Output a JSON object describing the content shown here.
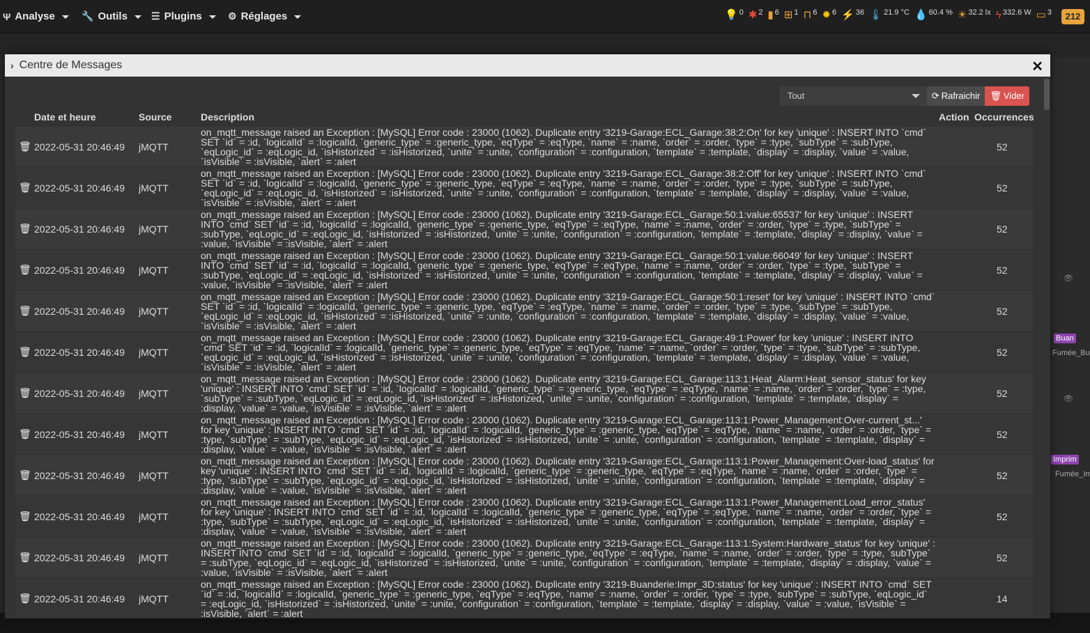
{
  "nav": {
    "analyse": "Analyse",
    "outils": "Outils",
    "plugins": "Plugins",
    "reglages": "Réglages"
  },
  "status": [
    {
      "icon": "bulb-icon",
      "glyph": "💡",
      "value": "0",
      "color": "#a6d14a"
    },
    {
      "icon": "person-running-icon",
      "glyph": "✱",
      "value": "2",
      "color": "#e74c3c"
    },
    {
      "icon": "door-icon",
      "glyph": "▮",
      "value": "6",
      "color": "#e8a33a"
    },
    {
      "icon": "window-icon",
      "glyph": "⊞",
      "value": "1",
      "color": "#e8a33a"
    },
    {
      "icon": "shutter-icon",
      "glyph": "⊓",
      "value": "6",
      "color": "#e8a33a"
    },
    {
      "icon": "lamp-icon",
      "glyph": "✹",
      "value": "6",
      "color": "#f1c40f"
    },
    {
      "icon": "plug-icon",
      "glyph": "⚡",
      "value": "36",
      "color": "#e74c3c"
    },
    {
      "icon": "thermometer-icon",
      "glyph": "🌡",
      "value": "21.9 °C",
      "color": "#5dade2"
    },
    {
      "icon": "humidity-icon",
      "glyph": "💧",
      "value": "60.4 %",
      "color": "#3498db"
    },
    {
      "icon": "sun-icon",
      "glyph": "☀",
      "value": "32.2 lx",
      "color": "#e8a33a"
    },
    {
      "icon": "power-icon",
      "glyph": "ϟ",
      "value": "332.6 W",
      "color": "#e74c3c"
    },
    {
      "icon": "screen-icon",
      "glyph": "▭",
      "value": "3",
      "color": "#e8a33a"
    }
  ],
  "notification_count": "212",
  "modal": {
    "title": "Centre de Messages",
    "filter_value": "Tout",
    "refresh_label": "Rafraichir",
    "clear_label": "Vider"
  },
  "table": {
    "headers": {
      "date": "Date et heure",
      "source": "Source",
      "description": "Description",
      "action": "Action",
      "occurrences": "Occurrences"
    },
    "rows": [
      {
        "date": "2022-05-31 20:46:49",
        "source": "jMQTT",
        "occ": "52",
        "desc": "on_mqtt_message raised an Exception : [MySQL] Error code : 23000 (1062). Duplicate entry '3219-Garage:ECL_Garage:38:2:On' for key 'unique' : INSERT INTO `cmd` SET `id` = :id, `logicalId` = :logicalId, `generic_type` = :generic_type, `eqType` = :eqType, `name` = :name, `order` = :order, `type` = :type, `subType` = :subType, `eqLogic_id` = :eqLogic_id, `isHistorized` = :isHistorized, `unite` = :unite, `configuration` = :configuration, `template` = :template, `display` = :display, `value` = :value, `isVisible` = :isVisible, `alert` = :alert"
      },
      {
        "date": "2022-05-31 20:46:49",
        "source": "jMQTT",
        "occ": "52",
        "desc": "on_mqtt_message raised an Exception : [MySQL] Error code : 23000 (1062). Duplicate entry '3219-Garage:ECL_Garage:38:2:Off' for key 'unique' : INSERT INTO `cmd` SET `id` = :id, `logicalId` = :logicalId, `generic_type` = :generic_type, `eqType` = :eqType, `name` = :name, `order` = :order, `type` = :type, `subType` = :subType, `eqLogic_id` = :eqLogic_id, `isHistorized` = :isHistorized, `unite` = :unite, `configuration` = :configuration, `template` = :template, `display` = :display, `value` = :value, `isVisible` = :isVisible, `alert` = :alert"
      },
      {
        "date": "2022-05-31 20:46:49",
        "source": "jMQTT",
        "occ": "52",
        "desc": "on_mqtt_message raised an Exception : [MySQL] Error code : 23000 (1062). Duplicate entry '3219-Garage:ECL_Garage:50:1:value:65537' for key 'unique' : INSERT INTO `cmd` SET `id` = :id, `logicalId` = :logicalId, `generic_type` = :generic_type, `eqType` = :eqType, `name` = :name, `order` = :order, `type` = :type, `subType` = :subType, `eqLogic_id` = :eqLogic_id, `isHistorized` = :isHistorized, `unite` = :unite, `configuration` = :configuration, `template` = :template, `display` = :display, `value` = :value, `isVisible` = :isVisible, `alert` = :alert"
      },
      {
        "date": "2022-05-31 20:46:49",
        "source": "jMQTT",
        "occ": "52",
        "desc": "on_mqtt_message raised an Exception : [MySQL] Error code : 23000 (1062). Duplicate entry '3219-Garage:ECL_Garage:50:1:value:66049' for key 'unique' : INSERT INTO `cmd` SET `id` = :id, `logicalId` = :logicalId, `generic_type` = :generic_type, `eqType` = :eqType, `name` = :name, `order` = :order, `type` = :type, `subType` = :subType, `eqLogic_id` = :eqLogic_id, `isHistorized` = :isHistorized, `unite` = :unite, `configuration` = :configuration, `template` = :template, `display` = :display, `value` = :value, `isVisible` = :isVisible, `alert` = :alert"
      },
      {
        "date": "2022-05-31 20:46:49",
        "source": "jMQTT",
        "occ": "52",
        "desc": "on_mqtt_message raised an Exception : [MySQL] Error code : 23000 (1062). Duplicate entry '3219-Garage:ECL_Garage:50:1:reset' for key 'unique' : INSERT INTO `cmd` SET `id` = :id, `logicalId` = :logicalId, `generic_type` = :generic_type, `eqType` = :eqType, `name` = :name, `order` = :order, `type` = :type, `subType` = :subType, `eqLogic_id` = :eqLogic_id, `isHistorized` = :isHistorized, `unite` = :unite, `configuration` = :configuration, `template` = :template, `display` = :display, `value` = :value, `isVisible` = :isVisible, `alert` = :alert"
      },
      {
        "date": "2022-05-31 20:46:49",
        "source": "jMQTT",
        "occ": "52",
        "desc": "on_mqtt_message raised an Exception : [MySQL] Error code : 23000 (1062). Duplicate entry '3219-Garage:ECL_Garage:49:1:Power' for key 'unique' : INSERT INTO `cmd` SET `id` = :id, `logicalId` = :logicalId, `generic_type` = :generic_type, `eqType` = :eqType, `name` = :name, `order` = :order, `type` = :type, `subType` = :subType, `eqLogic_id` = :eqLogic_id, `isHistorized` = :isHistorized, `unite` = :unite, `configuration` = :configuration, `template` = :template, `display` = :display, `value` = :value, `isVisible` = :isVisible, `alert` = :alert"
      },
      {
        "date": "2022-05-31 20:46:49",
        "source": "jMQTT",
        "occ": "52",
        "desc": "on_mqtt_message raised an Exception : [MySQL] Error code : 23000 (1062). Duplicate entry '3219-Garage:ECL_Garage:113:1:Heat_Alarm:Heat_sensor_status' for key 'unique' : INSERT INTO `cmd` SET `id` = :id, `logicalId` = :logicalId, `generic_type` = :generic_type, `eqType` = :eqType, `name` = :name, `order` = :order, `type` = :type, `subType` = :subType, `eqLogic_id` = :eqLogic_id, `isHistorized` = :isHistorized, `unite` = :unite, `configuration` = :configuration, `template` = :template, `display` = :display, `value` = :value, `isVisible` = :isVisible, `alert` = :alert"
      },
      {
        "date": "2022-05-31 20:46:49",
        "source": "jMQTT",
        "occ": "52",
        "desc": "on_mqtt_message raised an Exception : [MySQL] Error code : 23000 (1062). Duplicate entry '3219-Garage:ECL_Garage:113:1:Power_Management:Over-current_st...' for key 'unique' : INSERT INTO `cmd` SET `id` = :id, `logicalId` = :logicalId, `generic_type` = :generic_type, `eqType` = :eqType, `name` = :name, `order` = :order, `type` = :type, `subType` = :subType, `eqLogic_id` = :eqLogic_id, `isHistorized` = :isHistorized, `unite` = :unite, `configuration` = :configuration, `template` = :template, `display` = :display, `value` = :value, `isVisible` = :isVisible, `alert` = :alert"
      },
      {
        "date": "2022-05-31 20:46:49",
        "source": "jMQTT",
        "occ": "52",
        "desc": "on_mqtt_message raised an Exception : [MySQL] Error code : 23000 (1062). Duplicate entry '3219-Garage:ECL_Garage:113:1:Power_Management:Over-load_status' for key 'unique' : INSERT INTO `cmd` SET `id` = :id, `logicalId` = :logicalId, `generic_type` = :generic_type, `eqType` = :eqType, `name` = :name, `order` = :order, `type` = :type, `subType` = :subType, `eqLogic_id` = :eqLogic_id, `isHistorized` = :isHistorized, `unite` = :unite, `configuration` = :configuration, `template` = :template, `display` = :display, `value` = :value, `isVisible` = :isVisible, `alert` = :alert"
      },
      {
        "date": "2022-05-31 20:46:49",
        "source": "jMQTT",
        "occ": "52",
        "desc": "on_mqtt_message raised an Exception : [MySQL] Error code : 23000 (1062). Duplicate entry '3219-Garage:ECL_Garage:113:1:Power_Management:Load_error_status' for key 'unique' : INSERT INTO `cmd` SET `id` = :id, `logicalId` = :logicalId, `generic_type` = :generic_type, `eqType` = :eqType, `name` = :name, `order` = :order, `type` = :type, `subType` = :subType, `eqLogic_id` = :eqLogic_id, `isHistorized` = :isHistorized, `unite` = :unite, `configuration` = :configuration, `template` = :template, `display` = :display, `value` = :value, `isVisible` = :isVisible, `alert` = :alert"
      },
      {
        "date": "2022-05-31 20:46:49",
        "source": "jMQTT",
        "occ": "52",
        "desc": "on_mqtt_message raised an Exception : [MySQL] Error code : 23000 (1062). Duplicate entry '3219-Garage:ECL_Garage:113:1:System:Hardware_status' for key 'unique' : INSERT INTO `cmd` SET `id` = :id, `logicalId` = :logicalId, `generic_type` = :generic_type, `eqType` = :eqType, `name` = :name, `order` = :order, `type` = :type, `subType` = :subType, `eqLogic_id` = :eqLogic_id, `isHistorized` = :isHistorized, `unite` = :unite, `configuration` = :configuration, `template` = :template, `display` = :display, `value` = :value, `isVisible` = :isVisible, `alert` = :alert"
      },
      {
        "date": "2022-05-31 20:46:49",
        "source": "jMQTT",
        "occ": "14",
        "desc": "on_mqtt_message raised an Exception : [MySQL] Error code : 23000 (1062). Duplicate entry '3219-Buanderie:Impr_3D:status' for key 'unique' : INSERT INTO `cmd` SET `id` = :id, `logicalId` = :logicalId, `generic_type` = :generic_type, `eqType` = :eqType, `name` = :name, `order` = :order, `type` = :type, `subType` = :subType, `eqLogic_id` = :eqLogic_id, `isHistorized` = :isHistorized, `unite` = :unite, `configuration` = :configuration, `template` = :template, `display` = :display, `value` = :value, `isVisible` = :isVisible, `alert` = :alert"
      }
    ]
  },
  "background": {
    "label_buan": "Buan",
    "label_fumee_bu": "Fumée_Bu",
    "label_imprim": "Imprim",
    "label_fumee_im": "Fumée_Im"
  }
}
